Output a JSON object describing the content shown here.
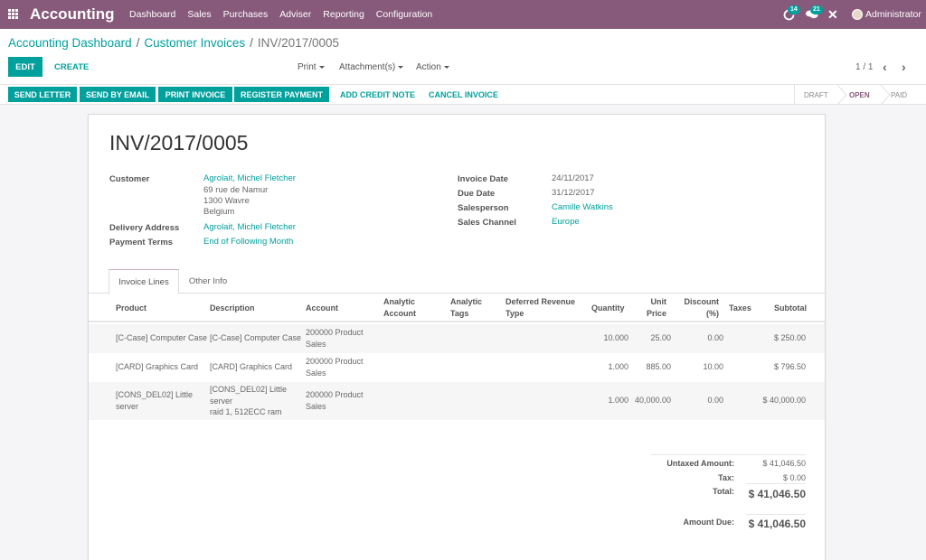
{
  "navbar": {
    "app_name": "Accounting",
    "menu": [
      "Dashboard",
      "Sales",
      "Purchases",
      "Adviser",
      "Reporting",
      "Configuration"
    ],
    "activity_count": "14",
    "messages_count": "21",
    "user": "Administrator",
    "icons": {
      "apps": "apps-grid-icon",
      "activity": "clock-icon",
      "messages": "chat-icon",
      "close": "close-icon"
    }
  },
  "breadcrumb": {
    "items": [
      "Accounting Dashboard",
      "Customer Invoices"
    ],
    "current": "INV/2017/0005",
    "separator": "/"
  },
  "toolbar": {
    "edit": "EDIT",
    "create": "CREATE",
    "print": "Print",
    "attachments": "Attachment(s)",
    "action": "Action",
    "pager": "1 / 1",
    "prev": "‹",
    "next": "›"
  },
  "statusbar": {
    "buttons": [
      "SEND LETTER",
      "SEND BY EMAIL",
      "PRINT INVOICE",
      "REGISTER PAYMENT"
    ],
    "links": [
      "ADD CREDIT NOTE",
      "CANCEL INVOICE"
    ],
    "stages": [
      "DRAFT",
      "OPEN",
      "PAID"
    ],
    "current_stage": "OPEN"
  },
  "invoice": {
    "number": "INV/2017/0005",
    "left_fields": {
      "customer_label": "Customer",
      "customer_name": "Agrolait, Michel Fletcher",
      "customer_address": [
        "69 rue de Namur",
        "1300 Wavre",
        "Belgium"
      ],
      "delivery_label": "Delivery Address",
      "delivery_value": "Agrolait, Michel Fletcher",
      "payment_terms_label": "Payment Terms",
      "payment_terms_value": "End of Following Month"
    },
    "right_fields": {
      "invoice_date_label": "Invoice Date",
      "invoice_date": "24/11/2017",
      "due_date_label": "Due Date",
      "due_date": "31/12/2017",
      "salesperson_label": "Salesperson",
      "salesperson": "Camille Watkins",
      "sales_channel_label": "Sales Channel",
      "sales_channel": "Europe"
    },
    "tabs": [
      "Invoice Lines",
      "Other Info"
    ],
    "columns": {
      "product": "Product",
      "description": "Description",
      "account": "Account",
      "analytic_account": [
        "Analytic",
        "Account"
      ],
      "analytic_tags": [
        "Analytic",
        "Tags"
      ],
      "deferred": [
        "Deferred Revenue",
        "Type"
      ],
      "quantity": "Quantity",
      "unit_price": [
        "Unit",
        "Price"
      ],
      "discount": [
        "Discount",
        "(%)"
      ],
      "taxes": "Taxes",
      "subtotal": "Subtotal"
    },
    "lines": [
      {
        "product": [
          "[C-Case] Computer Case"
        ],
        "description": [
          "[C-Case] Computer Case"
        ],
        "account": [
          "200000 Product",
          "Sales"
        ],
        "quantity": "10.000",
        "unit_price": "25.00",
        "discount": "0.00",
        "subtotal": "$ 250.00"
      },
      {
        "product": [
          "[CARD] Graphics Card"
        ],
        "description": [
          "[CARD] Graphics Card"
        ],
        "account": [
          "200000 Product",
          "Sales"
        ],
        "quantity": "1.000",
        "unit_price": "885.00",
        "discount": "10.00",
        "subtotal": "$ 796.50"
      },
      {
        "product": [
          "[CONS_DEL02] Little",
          "server"
        ],
        "description": [
          "[CONS_DEL02] Little",
          "server",
          "raid 1, 512ECC ram"
        ],
        "account": [
          "200000 Product",
          "Sales"
        ],
        "quantity": "1.000",
        "unit_price": "40,000.00",
        "discount": "0.00",
        "subtotal": "$ 40,000.00"
      }
    ],
    "totals": {
      "untaxed_label": "Untaxed Amount:",
      "untaxed": "$ 41,046.50",
      "tax_label": "Tax:",
      "tax": "$ 0.00",
      "total_label": "Total:",
      "total": "$ 41,046.50",
      "due_label": "Amount Due:",
      "due": "$ 41,046.50"
    }
  },
  "colors": {
    "brand": "#875a7b",
    "accent": "#00a09d"
  }
}
